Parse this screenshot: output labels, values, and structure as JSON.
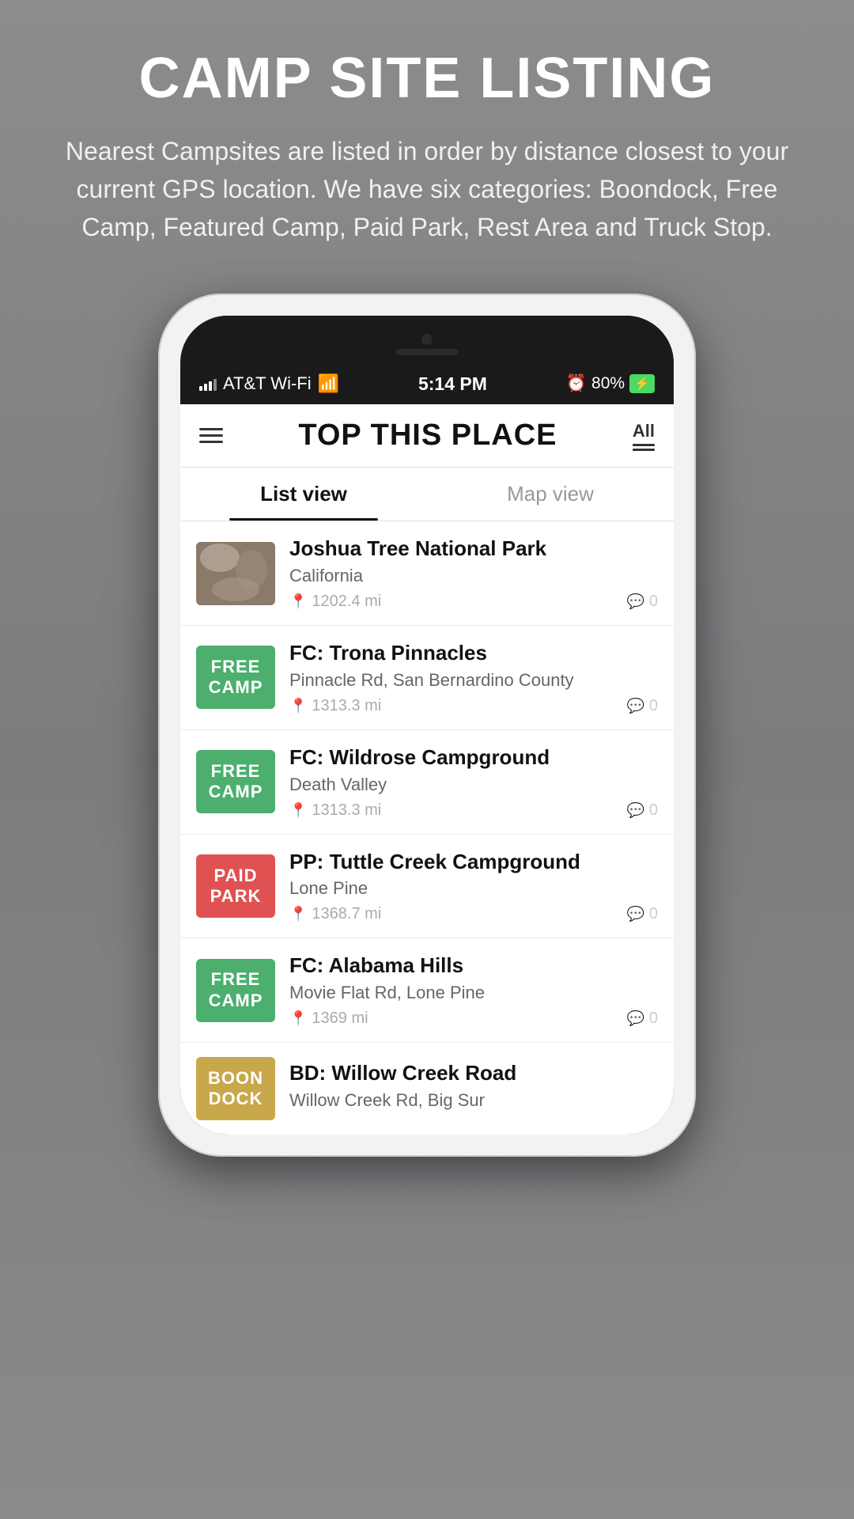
{
  "background": {
    "color": "#888a8c"
  },
  "header": {
    "title": "CAMP SITE LISTING",
    "subtitle": "Nearest Campsites are listed in order by distance closest to your current GPS location. We have six categories: Boondock, Free Camp, Featured Camp, Paid Park, Rest Area and Truck Stop."
  },
  "status_bar": {
    "carrier": "AT&T Wi-Fi",
    "time": "5:14 PM",
    "alarm_icon": "⏰",
    "battery_percent": "80%",
    "battery_icon": "⚡"
  },
  "app": {
    "title": "TOP THIS PLACE",
    "filter_label": "All",
    "tabs": [
      {
        "label": "List view",
        "active": true
      },
      {
        "label": "Map view",
        "active": false
      }
    ],
    "menu_icon": "hamburger-icon",
    "filter_icon": "filter-icon"
  },
  "listings": [
    {
      "id": 1,
      "badge_type": "photo",
      "badge_color": "",
      "badge_text": "",
      "name": "Joshua Tree National Park",
      "subtitle": "California",
      "distance": "1202.4 mi",
      "comments": "0"
    },
    {
      "id": 2,
      "badge_type": "free-camp",
      "badge_color": "#4caf6e",
      "badge_text": "FREE CAMP",
      "name": "FC: Trona Pinnacles",
      "subtitle": "Pinnacle Rd, San Bernardino County",
      "distance": "1313.3 mi",
      "comments": "0"
    },
    {
      "id": 3,
      "badge_type": "free-camp",
      "badge_color": "#4caf6e",
      "badge_text": "FREE CAMP",
      "name": "FC: Wildrose Campground",
      "subtitle": "Death Valley",
      "distance": "1313.3 mi",
      "comments": "0"
    },
    {
      "id": 4,
      "badge_type": "paid-park",
      "badge_color": "#e05252",
      "badge_text": "PAID PARK",
      "name": "PP: Tuttle Creek Campground",
      "subtitle": "Lone Pine",
      "distance": "1368.7 mi",
      "comments": "0"
    },
    {
      "id": 5,
      "badge_type": "free-camp",
      "badge_color": "#4caf6e",
      "badge_text": "FREE CAMP",
      "name": "FC: Alabama Hills",
      "subtitle": "Movie Flat Rd, Lone Pine",
      "distance": "1369 mi",
      "comments": "0"
    },
    {
      "id": 6,
      "badge_type": "boondock",
      "badge_color": "#c8a84b",
      "badge_text": "BOON DOCK",
      "name": "BD: Willow Creek Road",
      "subtitle": "Willow Creek Rd, Big Sur",
      "distance": "",
      "comments": ""
    }
  ]
}
